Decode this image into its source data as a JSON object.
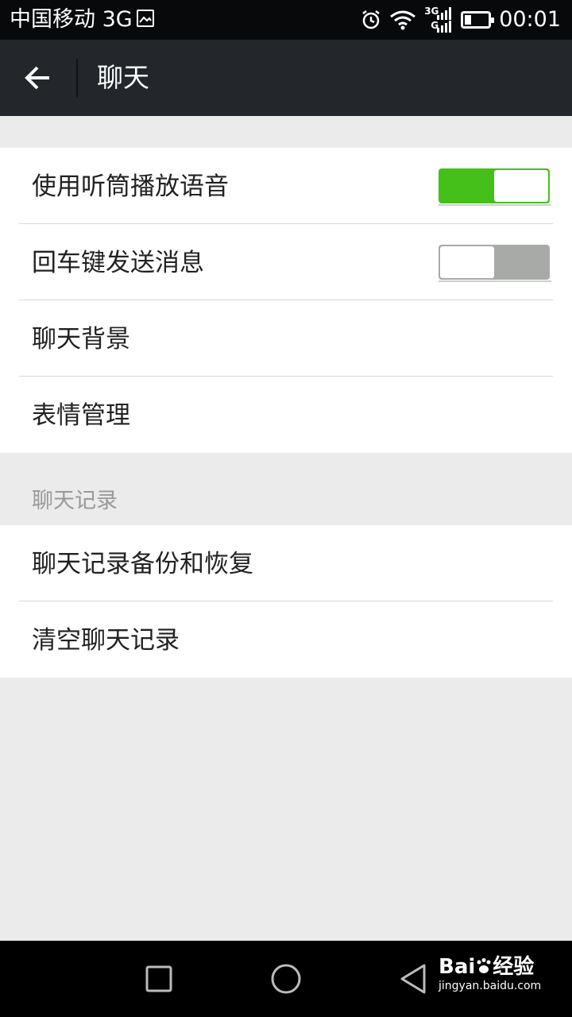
{
  "status_bar": {
    "carrier": "中国移动 3G",
    "network_badge_top": "3G",
    "network_badge_bottom": "G",
    "time": "00:01",
    "icons": [
      "image-icon",
      "alarm-icon",
      "wifi-icon",
      "signal-icon",
      "battery-icon"
    ]
  },
  "toolbar": {
    "back_icon": "arrow-left-icon",
    "title": "聊天"
  },
  "settings": {
    "group1": [
      {
        "label": "使用听筒播放语音",
        "control": "switch",
        "on": true
      },
      {
        "label": "回车键发送消息",
        "control": "switch",
        "on": false
      },
      {
        "label": "聊天背景"
      },
      {
        "label": "表情管理"
      }
    ],
    "section_header": "聊天记录",
    "group2": [
      {
        "label": "聊天记录备份和恢复"
      },
      {
        "label": "清空聊天记录"
      }
    ]
  },
  "colors": {
    "switch_on": "#45c01a",
    "switch_off": "#a8aaa7",
    "toolbar": "#23272b",
    "background": "#ebebeb"
  },
  "nav_bar": {
    "icons": [
      "recent-apps-icon",
      "home-icon",
      "back-triangle-icon"
    ],
    "watermark_brand": "Bai",
    "watermark_brand_suffix": "经验",
    "watermark_url": "jingyan.baidu.com"
  }
}
